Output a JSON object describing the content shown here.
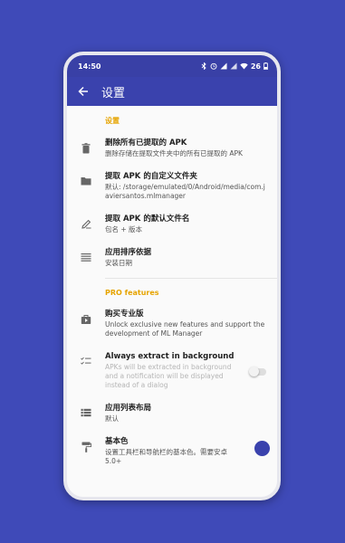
{
  "status": {
    "time": "14:50",
    "battery": "26"
  },
  "appbar": {
    "title": "设置"
  },
  "sections": {
    "settings_header": "设置",
    "pro_header": "PRO features"
  },
  "items": [
    {
      "title": "删除所有已提取的 APK",
      "subtitle": "删除存储在提取文件夹中的所有已提取的 APK"
    },
    {
      "title": "提取 APK 的自定义文件夹",
      "subtitle": "默认: /storage/emulated/0/Android/media/com.javiersantos.mlmanager"
    },
    {
      "title": "提取 APK 的默认文件名",
      "subtitle": "包名 + 版本"
    },
    {
      "title": "应用排序依据",
      "subtitle": "安装日期"
    },
    {
      "title": "购买专业版",
      "subtitle": "Unlock exclusive new features and support the development of ML Manager"
    },
    {
      "title": "Always extract in background",
      "subtitle": "APKs will be extracted in background and a notification will be displayed instead of a dialog"
    },
    {
      "title": "应用列表布局",
      "subtitle": "默认"
    },
    {
      "title": "基本色",
      "subtitle": "设置工具栏和导航栏的基本色。需要安卓 5.0+"
    }
  ],
  "colors": {
    "primary": "#3a42ad",
    "accent": "#e6a400",
    "background": "#3f4ab8"
  },
  "icons": {
    "back": "arrow-left-icon",
    "delete": "trash-icon",
    "folder": "folder-icon",
    "rename": "pencil-icon",
    "sort": "sort-lines-icon",
    "pro": "shop-bag-icon",
    "background": "checklist-icon",
    "layout": "list-layout-icon",
    "color": "paint-roller-icon"
  },
  "toggle": {
    "always_extract_background": false
  }
}
